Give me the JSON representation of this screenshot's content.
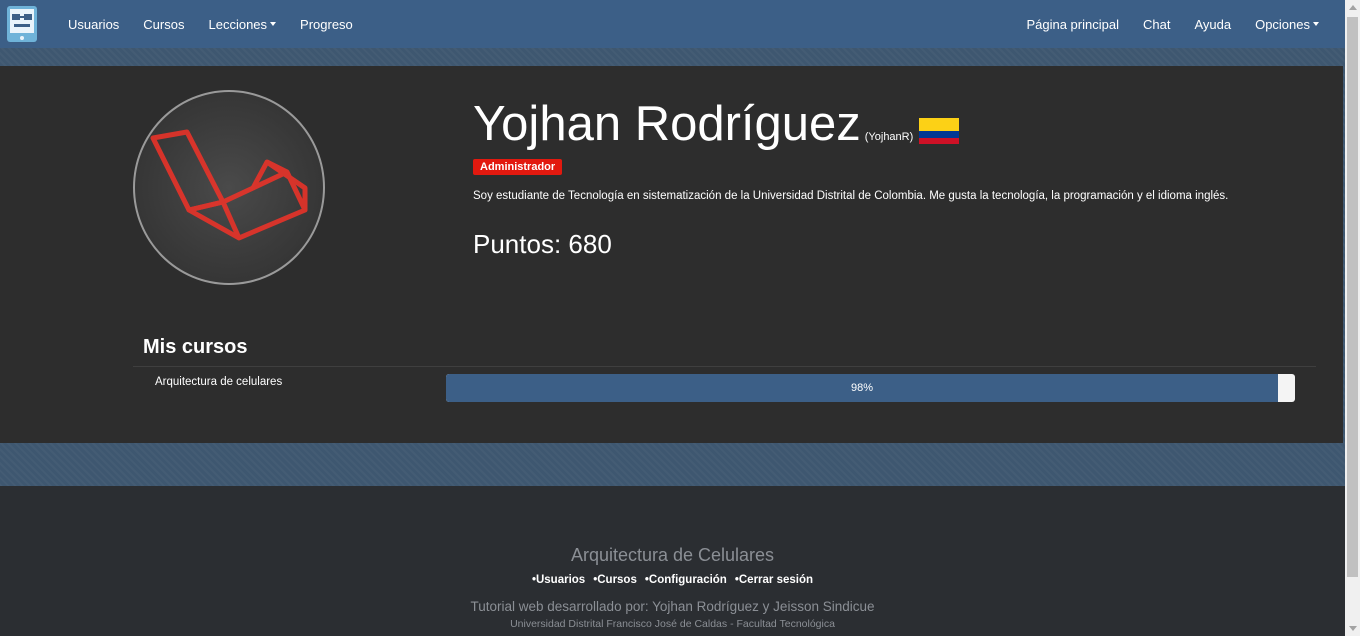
{
  "navbar": {
    "left_items": [
      {
        "label": "Usuarios",
        "dropdown": false
      },
      {
        "label": "Cursos",
        "dropdown": false
      },
      {
        "label": "Lecciones",
        "dropdown": true
      },
      {
        "label": "Progreso",
        "dropdown": false
      }
    ],
    "right_items": [
      {
        "label": "Página principal",
        "dropdown": false
      },
      {
        "label": "Chat",
        "dropdown": false
      },
      {
        "label": "Ayuda",
        "dropdown": false
      },
      {
        "label": "Opciones",
        "dropdown": true
      }
    ]
  },
  "profile": {
    "name": "Yojhan Rodríguez",
    "handle": "(YojhanR)",
    "role": "Administrador",
    "bio": "Soy estudiante de Tecnología en sistematización de la Universidad Distrital de Colombia. Me gusta la tecnología, la programación y el idioma inglés.",
    "points": "Puntos: 680"
  },
  "courses": {
    "title": "Mis cursos",
    "items": [
      {
        "name": "Arquitectura de celulares",
        "progress_label": "98%",
        "progress": 0.98
      }
    ]
  },
  "footer": {
    "title": "Arquitectura de Celulares",
    "links": [
      "Usuarios",
      "Cursos",
      "Configuración",
      "Cerrar sesión"
    ],
    "credit": "Tutorial web desarrollado por: Yojhan Rodríguez y Jeisson Sindicue",
    "university": "Universidad Distrital Francisco José de Caldas - Facultad Tecnológica"
  },
  "colors": {
    "navbar": "#3c5f87",
    "panel": "#2d2d2d",
    "badge": "#e2190f",
    "progress_fill": "#3c5f87",
    "footer": "#2b2e32"
  }
}
